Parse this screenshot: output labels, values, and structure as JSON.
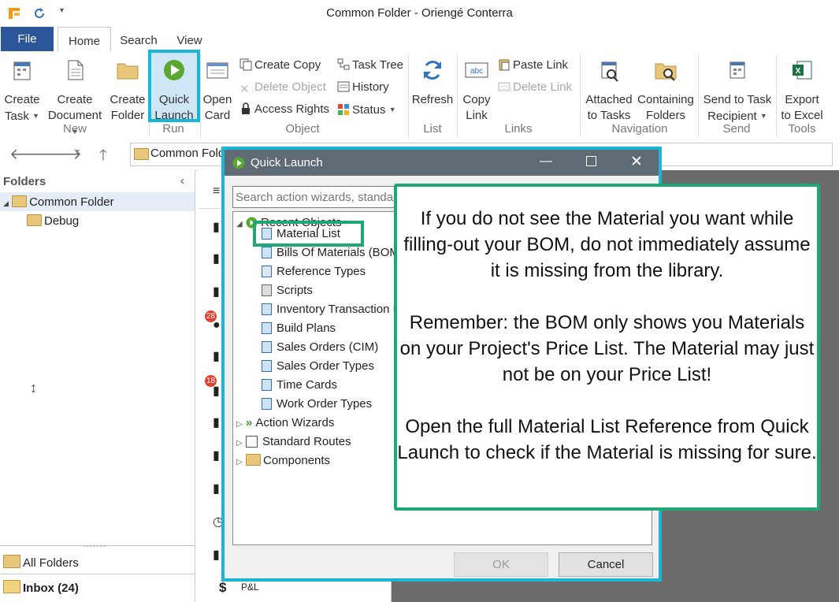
{
  "window": {
    "title": "Common Folder - Oriengé Conterra"
  },
  "ribbon_tabs": {
    "file": "File",
    "home": "Home",
    "search": "Search",
    "view": "View"
  },
  "ribbon": {
    "new": {
      "create_task": [
        "Create",
        "Task"
      ],
      "create_document": [
        "Create",
        "Document"
      ],
      "create_folder": [
        "Create",
        "Folder"
      ],
      "group": "New"
    },
    "run": {
      "quick_launch": [
        "Quick",
        "Launch"
      ],
      "group": "Run"
    },
    "object": {
      "open_card": [
        "Open",
        "Card"
      ],
      "create_copy": "Create Copy",
      "delete_object": "Delete Object",
      "access_rights": "Access Rights",
      "task_tree": "Task Tree",
      "history": "History",
      "status": "Status",
      "group": "Object"
    },
    "list": {
      "refresh": "Refresh",
      "group": "List"
    },
    "links": {
      "copy_link": [
        "Copy",
        "Link"
      ],
      "paste_link": "Paste Link",
      "delete_link": "Delete Link",
      "group": "Links"
    },
    "navigation": {
      "attached_to_tasks": [
        "Attached",
        "to Tasks"
      ],
      "containing_folders": [
        "Containing",
        "Folders"
      ],
      "group": "Navigation"
    },
    "send": {
      "send_to_task_recipient": [
        "Send to Task",
        "Recipient"
      ],
      "group": "Send"
    },
    "tools": {
      "export_to_excel": [
        "Export",
        "to Excel"
      ],
      "group": "Tools"
    }
  },
  "address": {
    "path": "Common Folder"
  },
  "folders": {
    "header": "Folders",
    "tree": [
      {
        "label": "Common Folder"
      },
      {
        "label": "Debug"
      }
    ],
    "bottom": {
      "all_folders": "All Folders",
      "inbox": "Inbox (24)"
    }
  },
  "midlist": {
    "badges": [
      "28",
      "18"
    ],
    "last_item": "P&L"
  },
  "dialog": {
    "title": "Quick Launch",
    "search_placeholder": "Search action wizards, standard",
    "tree": {
      "recent_objects": "Recent Objects",
      "recent_items": [
        "Material List",
        "Bills Of Materials (BOM",
        "Reference Types",
        "Scripts",
        "Inventory Transaction E",
        "Build Plans",
        "Sales Orders (CIM)",
        "Sales Order Types",
        "Time Cards",
        "Work Order Types"
      ],
      "action_wizards": "Action Wizards",
      "standard_routes": "Standard Routes",
      "components": "Components"
    },
    "ok": "OK",
    "cancel": "Cancel"
  },
  "callout": {
    "p1": "If you do not see the Material you want while filling-out your BOM, do not immediately assume it is missing from the library.",
    "p2": "Remember: the BOM only shows you Materials on your Project's Price List. The Material may just not be on your Price List!",
    "p3": "Open the full Material List Reference from Quick Launch to check if the Material is missing for sure."
  },
  "colors": {
    "highlight_cyan": "#1ab6d6",
    "highlight_green": "#1fa873",
    "file_tab": "#2b579a"
  }
}
